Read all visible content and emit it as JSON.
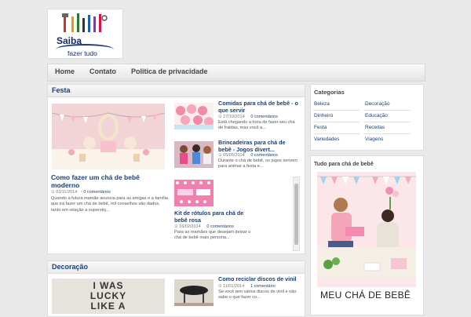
{
  "logo": {
    "line1": "Saiba",
    "line2": "fazer tudo"
  },
  "nav": {
    "items": [
      "Home",
      "Contato",
      "Politica de privacidade"
    ]
  },
  "festa": {
    "title": "Festa",
    "featured": {
      "title": "Como fazer um chá de bebê moderno",
      "date": "03/11/2014",
      "comments": "0 comentários",
      "excerpt": "Quando a futura mamãe anuncia para as amigas e a família que irá fazer um chá de bebê, mil conselhos são dados, tanto em relação a superstiç..."
    },
    "items": [
      {
        "title": "Comidas para chá de bebê - o que servir",
        "date": "27/10/2014",
        "comments": "0 comentários",
        "excerpt": "Está chegando a hora de fazer seu chá de fraldas, mas você a..."
      },
      {
        "title": "Brincadeiras para chá de bebê - Jogos divert...",
        "date": "05/05/2014",
        "comments": "0 comentários",
        "excerpt": "Durante o chá de bebê, os jogos servem para animar a festa e..."
      },
      {
        "title": "Kit de rótulos para chá de bebê rosa",
        "date": "16/02/2014",
        "comments": "0 comentários",
        "excerpt": "Para as mamães que desejam deixar o chá de bebê mais persona..."
      }
    ]
  },
  "decoracao": {
    "title": "Decoração",
    "featured_image_text": [
      "I WAS",
      "LUCKY",
      "LIKE A"
    ],
    "items": [
      {
        "title": "Como reciclar discos de vinil",
        "date": "11/01/2014",
        "comments": "1 comentário",
        "excerpt": "Se você tem vários discos de vinil e não sabe o que fazer co..."
      }
    ]
  },
  "sidebar": {
    "categories_title": "Categorias",
    "categories": [
      "Beleza",
      "Decoração",
      "Dinheiro",
      "Educação",
      "Festa",
      "Receitas",
      "Variedades",
      "Viagens"
    ],
    "ad_title": "Tudo para chá de bebê",
    "ad_caption": "MEU CHÁ DE BEBÊ"
  },
  "colors": {
    "link": "#1b3f78",
    "background": "#e9e9e9",
    "panel": "#ffffff"
  }
}
